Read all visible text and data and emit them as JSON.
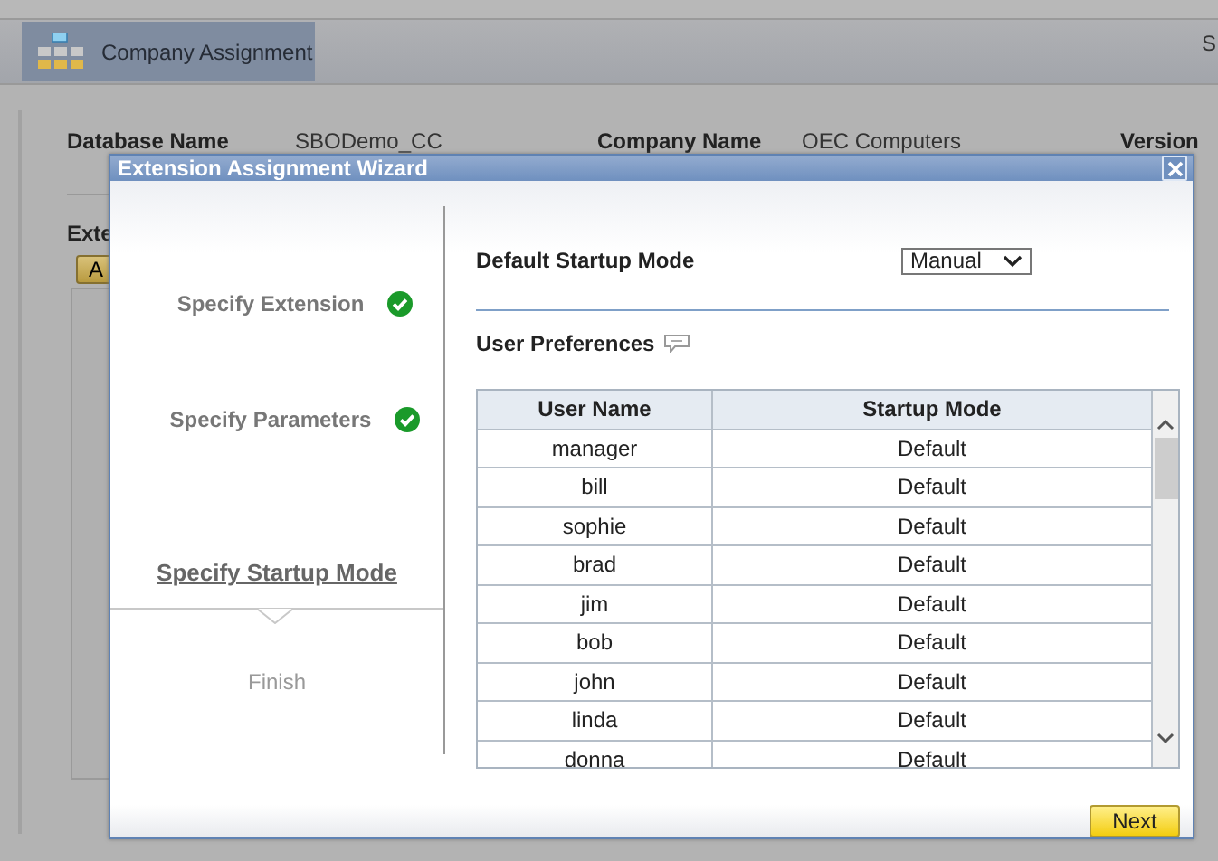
{
  "background": {
    "tab": {
      "label": "Company Assignment"
    },
    "corner_text": "S",
    "fields": [
      {
        "label": "Database Name",
        "value": "SBODemo_CC"
      },
      {
        "label": "Company Name",
        "value": "OEC Computers"
      },
      {
        "label": "Version"
      }
    ],
    "section_title": "Exte",
    "button": "A"
  },
  "dialog": {
    "title": "Extension Assignment Wizard",
    "steps": [
      {
        "label": "Specify Extension",
        "done": true,
        "selected": false
      },
      {
        "label": "Specify Parameters",
        "done": true,
        "selected": false
      },
      {
        "label": "Specify Startup Mode",
        "done": false,
        "selected": true
      },
      {
        "label": "Finish",
        "done": false,
        "selected": false
      }
    ],
    "default_startup_mode": {
      "label": "Default Startup Mode",
      "value": "Manual"
    },
    "user_preferences": {
      "title": "User Preferences",
      "columns": [
        "User Name",
        "Startup Mode"
      ],
      "rows": [
        [
          "manager",
          "Default"
        ],
        [
          "bill",
          "Default"
        ],
        [
          "sophie",
          "Default"
        ],
        [
          "brad",
          "Default"
        ],
        [
          "jim",
          "Default"
        ],
        [
          "bob",
          "Default"
        ],
        [
          "john",
          "Default"
        ],
        [
          "linda",
          "Default"
        ],
        [
          "donna",
          "Default"
        ]
      ]
    },
    "next_button": "Next"
  }
}
